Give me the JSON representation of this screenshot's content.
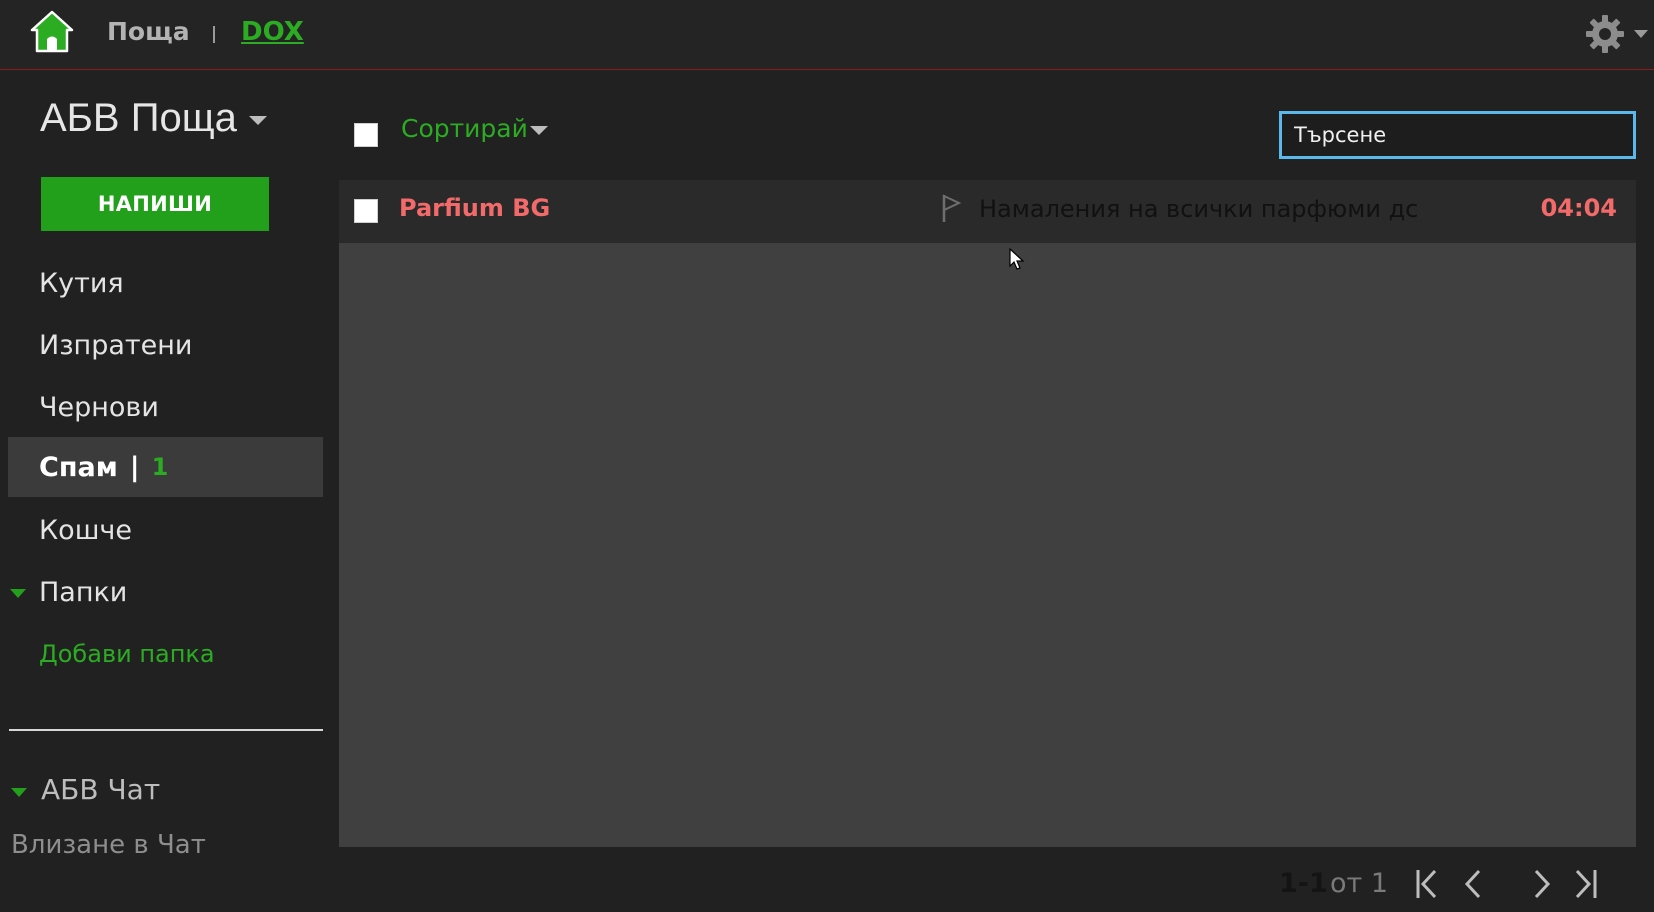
{
  "topbar": {
    "app_name": "Поща",
    "dox_label": "DOX",
    "icons": {
      "home": "home-icon",
      "settings": "gear-icon"
    }
  },
  "sidebar": {
    "brand": "АБВ Поща",
    "compose_label": "НАПИШИ",
    "items": [
      {
        "label": "Кутия"
      },
      {
        "label": "Изпратени"
      },
      {
        "label": "Чернови"
      },
      {
        "label": "Спам",
        "count": "1",
        "active": true
      },
      {
        "label": "Кошче"
      },
      {
        "label": "Папки",
        "expandable": true
      }
    ],
    "add_folder": "Добави папка",
    "chat_title": "АБВ Чат",
    "chat_login": "Влизане в Чат"
  },
  "toolbar": {
    "sort_label": "Сортирай",
    "search_placeholder": "Търсене"
  },
  "messages": [
    {
      "sender": "Parfium BG",
      "subject": "Намаления на всички парфюми дс",
      "time": "04:04",
      "flagged": false
    }
  ],
  "pagination": {
    "range": "1-1",
    "of_text": "от 1"
  },
  "colors": {
    "accent": "#23a01b",
    "unread": "#f36a6a",
    "search_border": "#5ab8ea",
    "topbar_border": "#8a1c1c"
  }
}
